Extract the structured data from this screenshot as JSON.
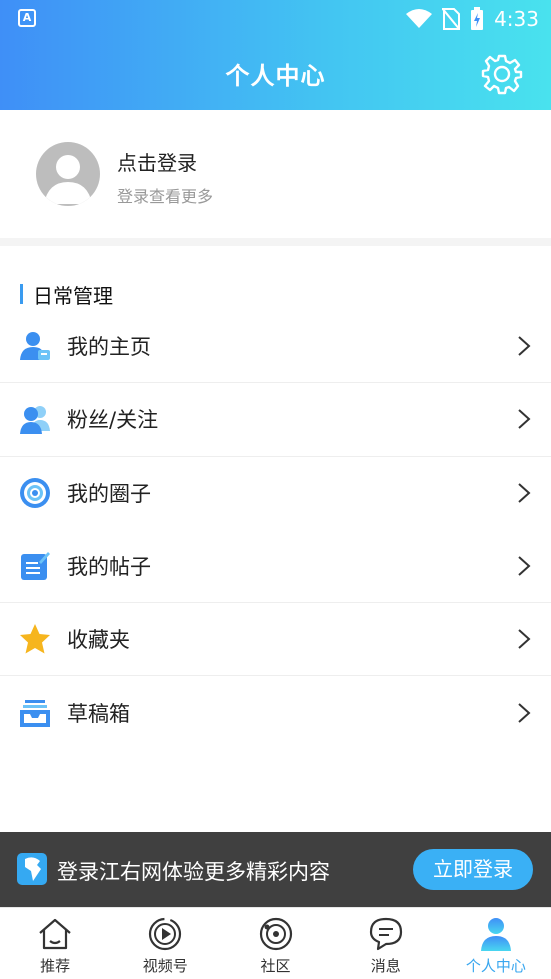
{
  "status_bar": {
    "time": "4:33",
    "app_icon_letter": "A"
  },
  "header": {
    "title": "个人中心"
  },
  "profile": {
    "login_title": "点击登录",
    "login_subtitle": "登录查看更多"
  },
  "section": {
    "title": "日常管理"
  },
  "menu": [
    {
      "label": "我的主页",
      "icon": "user-home-icon"
    },
    {
      "label": "粉丝/关注",
      "icon": "followers-icon"
    },
    {
      "label": "我的圈子",
      "icon": "circle-target-icon"
    },
    {
      "label": "我的帖子",
      "icon": "post-edit-icon"
    },
    {
      "label": "收藏夹",
      "icon": "star-icon"
    },
    {
      "label": "草稿箱",
      "icon": "inbox-tray-icon"
    }
  ],
  "banner": {
    "text": "登录江右网体验更多精彩内容",
    "button": "立即登录"
  },
  "tabbar": [
    {
      "label": "推荐",
      "icon": "home-icon",
      "active": false
    },
    {
      "label": "视频号",
      "icon": "video-play-icon",
      "active": false
    },
    {
      "label": "社区",
      "icon": "community-icon",
      "active": false
    },
    {
      "label": "消息",
      "icon": "chat-bubble-icon",
      "active": false
    },
    {
      "label": "个人中心",
      "icon": "profile-icon",
      "active": true
    }
  ],
  "colors": {
    "accent": "#3aa7ef",
    "header_start": "#3f8ff7",
    "header_end": "#49e2ee",
    "banner_bg": "#404040"
  }
}
